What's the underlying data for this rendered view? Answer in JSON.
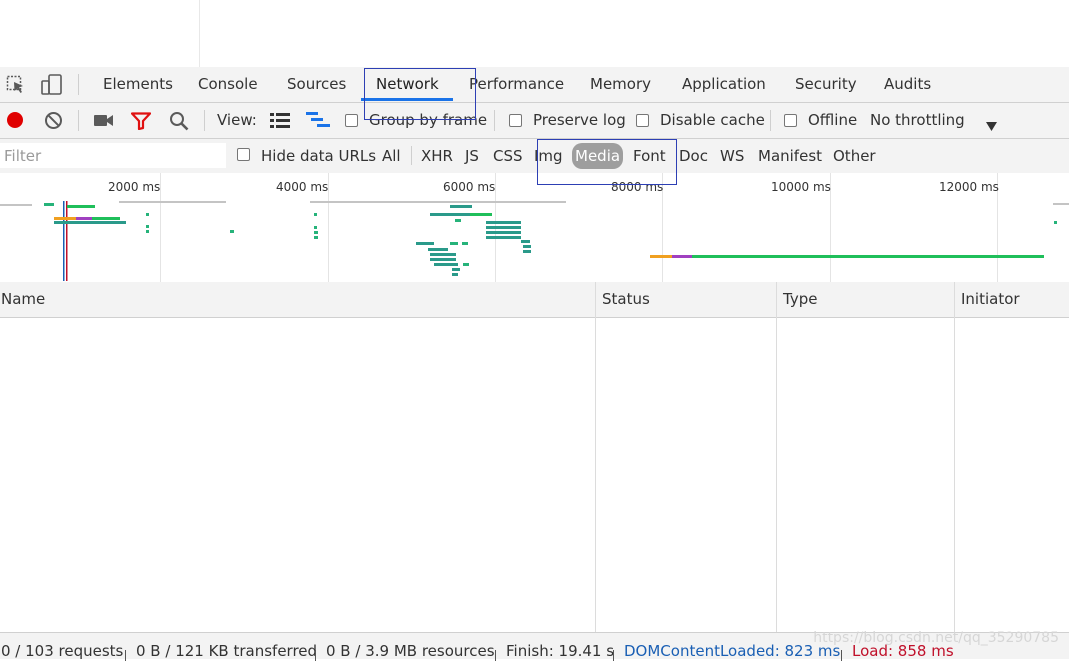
{
  "devtools": {
    "tabs": [
      {
        "label": "Elements"
      },
      {
        "label": "Console"
      },
      {
        "label": "Sources"
      },
      {
        "label": "Network",
        "active": true
      },
      {
        "label": "Performance"
      },
      {
        "label": "Memory"
      },
      {
        "label": "Application"
      },
      {
        "label": "Security"
      },
      {
        "label": "Audits"
      }
    ]
  },
  "toolbar": {
    "view_label": "View:",
    "group_by_frame": "Group by frame",
    "preserve_log": "Preserve log",
    "disable_cache": "Disable cache",
    "offline": "Offline",
    "throttling": "No throttling"
  },
  "filter": {
    "placeholder": "Filter",
    "hide_data_urls": "Hide data URLs",
    "types": [
      "All",
      "XHR",
      "JS",
      "CSS",
      "Img",
      "Media",
      "Font",
      "Doc",
      "WS",
      "Manifest",
      "Other"
    ],
    "selected_type": "Media"
  },
  "overview": {
    "ticks": [
      "2000 ms",
      "4000 ms",
      "6000 ms",
      "8000 ms",
      "10000 ms",
      "12000 ms"
    ]
  },
  "grid": {
    "columns": [
      "Name",
      "Status",
      "Type",
      "Initiator"
    ]
  },
  "status": {
    "requests": "0 / 103 requests",
    "transferred": "0 B / 121 KB transferred",
    "resources": "0 B / 3.9 MB resources",
    "finish": "Finish: 19.41 s",
    "dom_content_loaded": "DOMContentLoaded: 823 ms",
    "load": "Load: 858 ms"
  },
  "watermark": "https://blog.csdn.net/qq_35290785",
  "colors": {
    "accent": "#1a73e8",
    "record_red": "#e00000",
    "dcl_blue": "#1a5fb4",
    "load_red": "#c0102a",
    "annotation": "#2d3fb4"
  }
}
